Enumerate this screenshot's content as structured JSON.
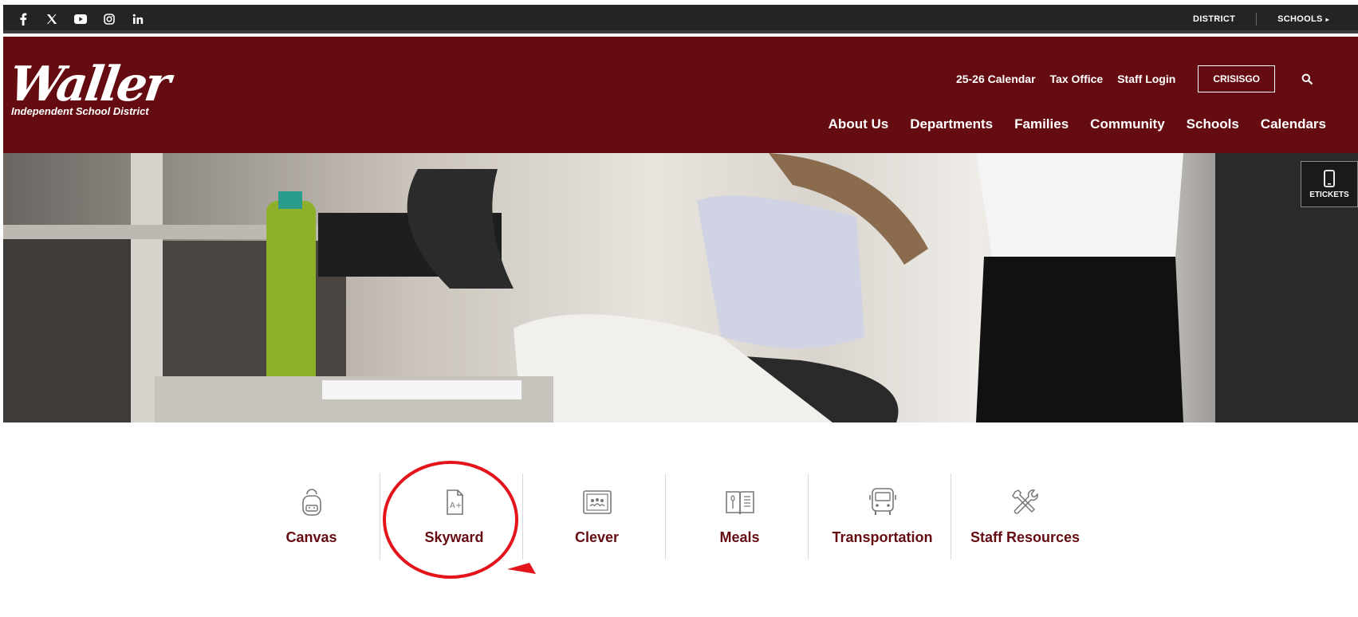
{
  "topbar": {
    "social_icons": [
      "facebook-icon",
      "x-icon",
      "youtube-icon",
      "instagram-icon",
      "linkedin-icon"
    ],
    "district_label": "DISTRICT",
    "schools_label": "SCHOOLS"
  },
  "header": {
    "logo_script": "Waller",
    "logo_subtitle": "Independent School District",
    "utility_links": [
      "25-26 Calendar",
      "Tax Office",
      "Staff Login"
    ],
    "crisisgo_label": "CRISISGO",
    "nav": [
      "About Us",
      "Departments",
      "Families",
      "Community",
      "Schools",
      "Calendars"
    ]
  },
  "hero": {
    "etickets_label": "ETICKETS"
  },
  "quick_links": [
    {
      "label": "Canvas",
      "icon": "backpack-icon"
    },
    {
      "label": "Skyward",
      "icon": "grade-document-icon"
    },
    {
      "label": "Clever",
      "icon": "classroom-board-icon"
    },
    {
      "label": "Meals",
      "icon": "menu-book-icon"
    },
    {
      "label": "Transportation",
      "icon": "bus-icon"
    },
    {
      "label": "Staff Resources",
      "icon": "tools-icon"
    }
  ],
  "colors": {
    "brand": "#650c12",
    "topbar": "#242424",
    "annotation": "#e3141b"
  }
}
